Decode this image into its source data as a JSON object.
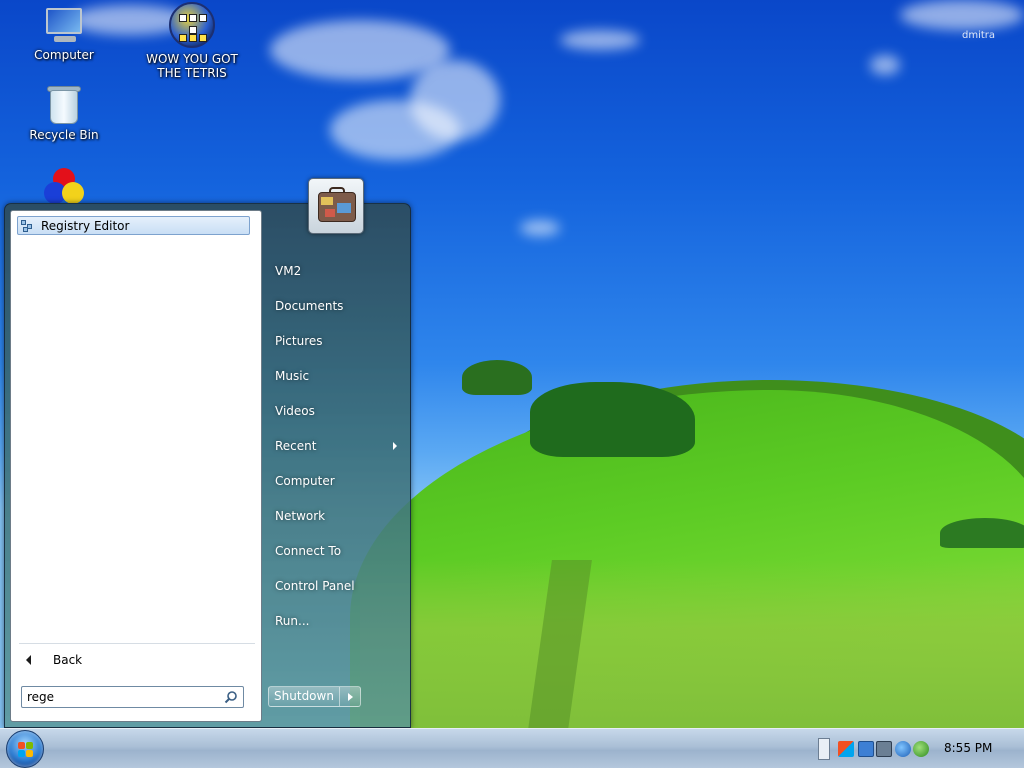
{
  "desktop": {
    "watermark": "dmitra",
    "icons": [
      {
        "label": "Computer",
        "icon": "computer-icon"
      },
      {
        "label": "WOW YOU GOT THE TETRIS",
        "icon": "tetris-icon"
      },
      {
        "label": "Recycle Bin",
        "icon": "recycle-bin-icon"
      },
      {
        "label": "",
        "icon": "rgb-circles-icon"
      }
    ]
  },
  "start_menu": {
    "search_results": [
      {
        "label": "Registry Editor",
        "icon": "registry-editor-icon"
      }
    ],
    "back_label": "Back",
    "search_value": "rege",
    "right_items": [
      {
        "label": "VM2"
      },
      {
        "label": "Documents"
      },
      {
        "label": "Pictures"
      },
      {
        "label": "Music"
      },
      {
        "label": "Videos"
      },
      {
        "label": "Recent",
        "has_submenu": true
      },
      {
        "label": "Computer"
      },
      {
        "label": "Network"
      },
      {
        "label": "Connect To"
      },
      {
        "label": "Control Panel"
      },
      {
        "label": "Run..."
      }
    ],
    "shutdown_label": "Shutdown",
    "user_tile_icon": "suitcase-icon"
  },
  "taskbar": {
    "start_icon": "windows-orb-icon",
    "tray_icons": [
      "flag-icon",
      "network-icon",
      "volume-icon",
      "globe-icon",
      "security-icon"
    ],
    "clock": "8:55 PM"
  }
}
